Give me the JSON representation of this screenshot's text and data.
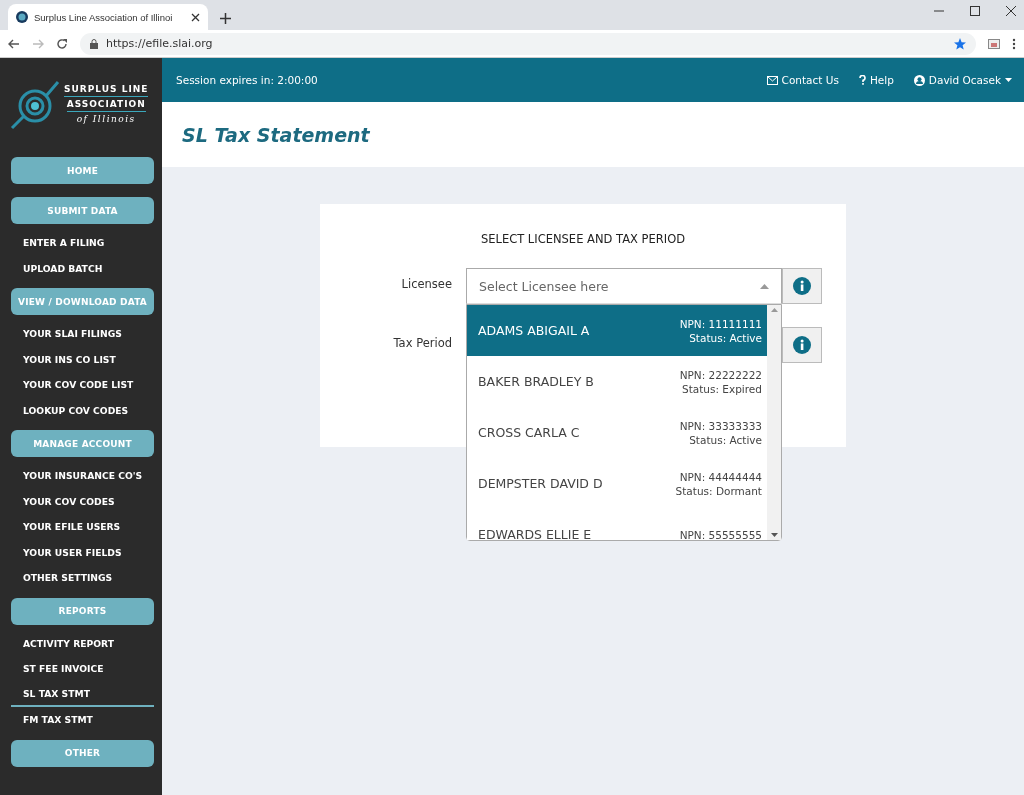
{
  "browser": {
    "tab_title": "Surplus Line Association of Illinoi",
    "url": "https://efile.slai.org"
  },
  "logo": {
    "line_1": "SURPLUS LINE",
    "line_2": "ASSOCIATION",
    "line_3": "of Illinois"
  },
  "header": {
    "session": "Session expires in: 2:00:00",
    "contact": "Contact Us",
    "help": "Help",
    "user": "David Ocasek"
  },
  "page_title": "SL Tax Statement",
  "sidebar": {
    "items": [
      {
        "kind": "section",
        "label": "HOME",
        "selected": false
      },
      {
        "kind": "section",
        "label": "SUBMIT DATA",
        "selected": false
      },
      {
        "kind": "link",
        "label": "ENTER A FILING",
        "selected": false
      },
      {
        "kind": "link",
        "label": "UPLOAD BATCH",
        "selected": false
      },
      {
        "kind": "section",
        "label": "VIEW / DOWNLOAD DATA",
        "selected": false
      },
      {
        "kind": "link",
        "label": "YOUR SLAI FILINGS",
        "selected": false
      },
      {
        "kind": "link",
        "label": "YOUR INS CO LIST",
        "selected": false
      },
      {
        "kind": "link",
        "label": "YOUR COV CODE LIST",
        "selected": false
      },
      {
        "kind": "link",
        "label": "LOOKUP COV CODES",
        "selected": false
      },
      {
        "kind": "section",
        "label": "MANAGE ACCOUNT",
        "selected": false
      },
      {
        "kind": "link",
        "label": "YOUR INSURANCE CO'S",
        "selected": false
      },
      {
        "kind": "link",
        "label": "YOUR COV CODES",
        "selected": false
      },
      {
        "kind": "link",
        "label": "YOUR EFILE USERS",
        "selected": false
      },
      {
        "kind": "link",
        "label": "YOUR USER FIELDS",
        "selected": false
      },
      {
        "kind": "link",
        "label": "OTHER SETTINGS",
        "selected": false
      },
      {
        "kind": "section",
        "label": "REPORTS",
        "selected": false
      },
      {
        "kind": "link",
        "label": "ACTIVITY REPORT",
        "selected": false
      },
      {
        "kind": "link",
        "label": "ST FEE INVOICE",
        "selected": false
      },
      {
        "kind": "link",
        "label": "SL TAX STMT",
        "selected": true
      },
      {
        "kind": "link",
        "label": "FM TAX STMT",
        "selected": false
      },
      {
        "kind": "section",
        "label": "OTHER",
        "selected": false
      }
    ]
  },
  "form": {
    "heading": "SELECT LICENSEE AND TAX PERIOD",
    "licensee": {
      "label": "Licensee",
      "placeholder": "Select Licensee here",
      "expanded": true,
      "options": [
        {
          "name": "ADAMS ABIGAIL A",
          "npn": "NPN: 11111111",
          "status": "Status: Active",
          "selected": true
        },
        {
          "name": "BAKER BRADLEY B",
          "npn": "NPN: 22222222",
          "status": "Status: Expired",
          "selected": false
        },
        {
          "name": "CROSS CARLA C",
          "npn": "NPN: 33333333",
          "status": "Status: Active",
          "selected": false
        },
        {
          "name": "DEMPSTER DAVID D",
          "npn": "NPN: 44444444",
          "status": "Status: Dormant",
          "selected": false
        },
        {
          "name": "EDWARDS ELLIE E",
          "npn": "NPN: 55555555",
          "selected": false
        }
      ]
    },
    "tax_period": {
      "label": "Tax Period"
    }
  }
}
